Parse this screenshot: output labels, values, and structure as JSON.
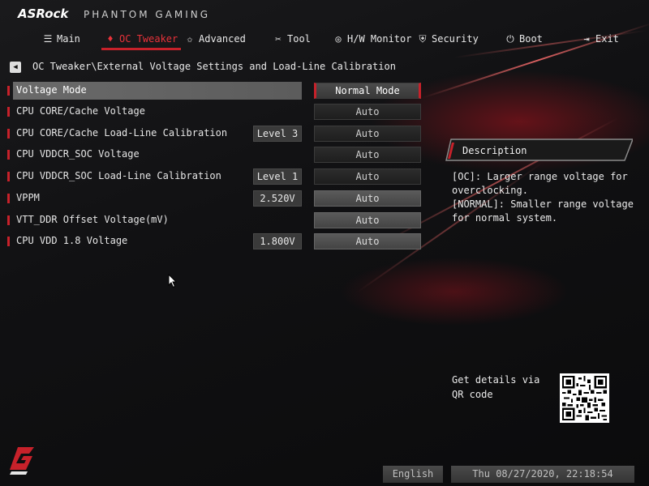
{
  "brand": {
    "logo": "ASRock",
    "subbrand": "PHANTOM GAMING"
  },
  "nav": [
    {
      "label": "Main",
      "icon": "menu-icon",
      "active": false
    },
    {
      "label": "OC Tweaker",
      "icon": "flame-icon",
      "active": true
    },
    {
      "label": "Advanced",
      "icon": "star-icon",
      "active": false
    },
    {
      "label": "Tool",
      "icon": "tools-icon",
      "active": false
    },
    {
      "label": "H/W Monitor",
      "icon": "monitor-icon",
      "active": false
    },
    {
      "label": "Security",
      "icon": "shield-icon",
      "active": false
    },
    {
      "label": "Boot",
      "icon": "power-icon",
      "active": false
    },
    {
      "label": "Exit",
      "icon": "exit-icon",
      "active": false
    }
  ],
  "breadcrumb": "OC Tweaker\\External Voltage Settings and Load-Line Calibration",
  "settings": [
    {
      "label": "Voltage Mode",
      "current": "",
      "value": "Normal Mode"
    },
    {
      "label": "CPU CORE/Cache Voltage",
      "current": "",
      "value": "Auto"
    },
    {
      "label": "CPU CORE/Cache Load-Line Calibration",
      "current": "Level 3",
      "value": "Auto"
    },
    {
      "label": "CPU VDDCR_SOC Voltage",
      "current": "",
      "value": "Auto"
    },
    {
      "label": "CPU VDDCR_SOC Load-Line Calibration",
      "current": "Level 1",
      "value": "Auto"
    },
    {
      "label": "VPPM",
      "current": "2.520V",
      "value": "Auto"
    },
    {
      "label": "VTT_DDR Offset Voltage(mV)",
      "current": "",
      "value": "Auto"
    },
    {
      "label": "CPU VDD 1.8 Voltage",
      "current": "1.800V",
      "value": "Auto"
    }
  ],
  "description": {
    "title": "Description",
    "lines": [
      "[OC]: Larger range voltage for",
      "overclocking.",
      "[NORMAL]: Smaller range voltage",
      "for normal system."
    ]
  },
  "qr": {
    "text": "Get details via QR code"
  },
  "footer": {
    "language": "English",
    "datetime": "Thu 08/27/2020, 22:18:54"
  },
  "colors": {
    "accent": "#c7212a",
    "background": "#0e0e0f"
  }
}
